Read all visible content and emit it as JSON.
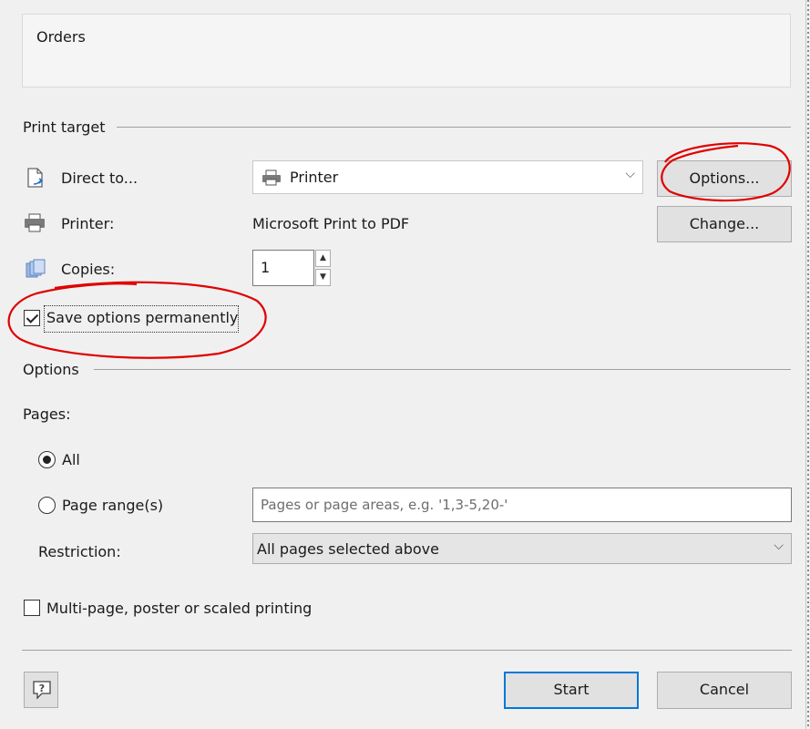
{
  "header": {
    "title": "Orders"
  },
  "print_target": {
    "section_label": "Print target",
    "direct_to_label": "Direct to...",
    "direct_to_value": "Printer",
    "options_button": "Options...",
    "printer_label": "Printer:",
    "printer_value": "Microsoft Print to PDF",
    "change_button": "Change...",
    "copies_label": "Copies:",
    "copies_value": "1",
    "save_options_label": "Save options permanently",
    "save_options_checked": true
  },
  "options": {
    "section_label": "Options",
    "pages_label": "Pages:",
    "all_label": "All",
    "page_range_label": "Page range(s)",
    "page_range_placeholder": "Pages or page areas, e.g. '1,3-5,20-'",
    "restriction_label": "Restriction:",
    "restriction_value": "All pages selected above",
    "multipage_label": "Multi-page, poster or scaled printing",
    "multipage_checked": false
  },
  "footer": {
    "start_button": "Start",
    "cancel_button": "Cancel"
  },
  "colors": {
    "annotation": "#e00000",
    "focus_border": "#0078d7"
  }
}
